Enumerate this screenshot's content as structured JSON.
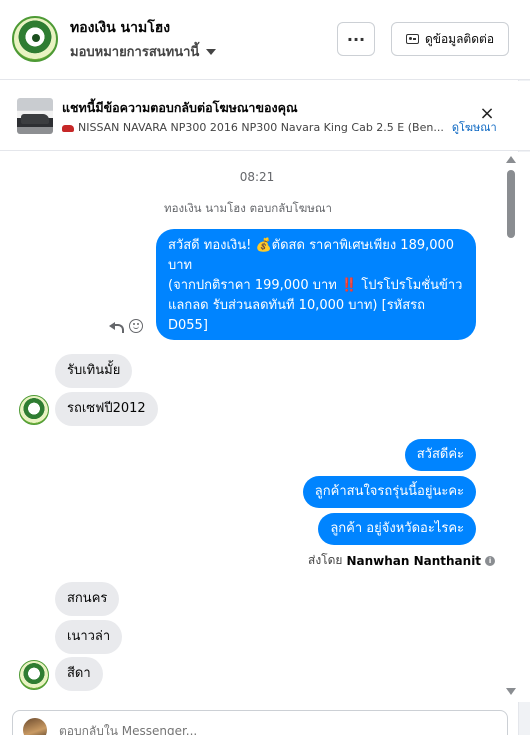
{
  "header": {
    "name": "ทองเงิน นามโฮง",
    "assign_label": "มอบหมายการสนทนานี้",
    "more_label": "···",
    "contact_label": "ดูข้อมูลติดต่อ"
  },
  "ad_banner": {
    "title": "แชทนี้มีข้อความตอบกลับต่อโฆษณาของคุณ",
    "subtitle": "NISSAN NAVARA NP300 2016 NP300 Navara King Cab 2.5 E (Ben...",
    "link": "ดูโฆษณา",
    "close_label": "×"
  },
  "chat": {
    "time": "08:21",
    "replied_note": "ทองเงิน นามโฮง ตอบกลับโฆษณา",
    "ad_message": {
      "line1": "สวัสดี ทองเงิน! 💰ตัดสด ราคาพิเศษเพียง 189,000",
      "line2": "บาท",
      "line3": "(จากปกติราคา 199,000 บาท ‼️ โปรโปรโมชั่นข้าว",
      "line4": "แลกลด รับส่วนลดทันที 10,000 บาท) [รหัสรถ",
      "line5": "D055]"
    },
    "incoming_1": [
      "รับเทินมั้ย",
      "รถเซฟปี2012"
    ],
    "outgoing": [
      "สวัสดีค่ะ",
      "ลูกค้าสนใจรถรุ่นนี้อยู่นะคะ",
      "ลูกค้า อยู่จังหวัดอะไรคะ"
    ],
    "sent_by_prefix": "ส่งโดย",
    "sent_by_name": "Nanwhan Nanthanit",
    "incoming_2": [
      "สกนคร",
      "เนาวล่า",
      "สีดา"
    ]
  },
  "composer": {
    "placeholder": "ตอบกลับใน Messenger..."
  },
  "colors": {
    "accent": "#0084ff",
    "incoming_bubble": "#e9eaed",
    "link": "#0a66c2"
  },
  "icons": {
    "more": "more-dots-icon",
    "contact": "contact-card-icon",
    "close": "close-icon",
    "reply": "reply-icon",
    "react": "smile-icon",
    "info": "info-icon"
  }
}
